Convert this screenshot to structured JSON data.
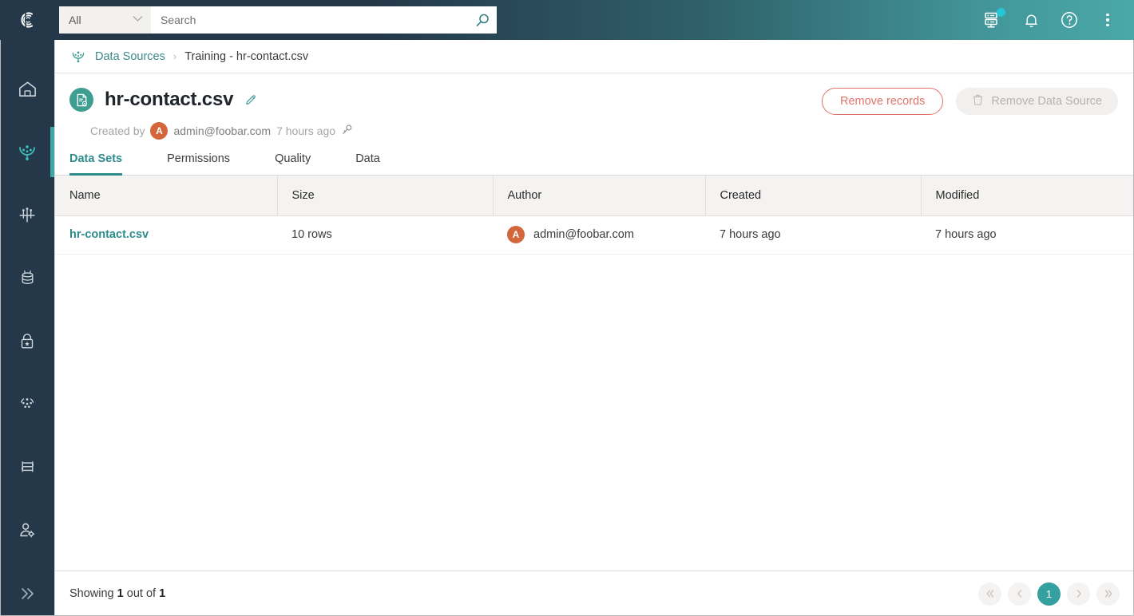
{
  "topbar": {
    "logo_icon": "c-logo-icon",
    "search": {
      "scope_value": "All",
      "scope_caret_icon": "chevron-down-icon",
      "placeholder": "Search",
      "value": "",
      "search_icon": "search-icon"
    },
    "icons": [
      {
        "name": "server-tasks-icon",
        "has_badge": true
      },
      {
        "name": "bell-icon",
        "has_badge": false
      },
      {
        "name": "help-circle-icon",
        "has_badge": false
      },
      {
        "name": "kebab-menu-icon",
        "has_badge": false
      }
    ]
  },
  "sidebar": {
    "items": [
      {
        "name": "sidebar-item-home",
        "icon": "home-icon",
        "active": false
      },
      {
        "name": "sidebar-item-data-sources",
        "icon": "data-sources-icon",
        "active": true
      },
      {
        "name": "sidebar-item-catalog",
        "icon": "catalog-network-icon",
        "active": false
      },
      {
        "name": "sidebar-item-database",
        "icon": "database-icon",
        "active": false
      },
      {
        "name": "sidebar-item-policies",
        "icon": "lock-star-icon",
        "active": false
      },
      {
        "name": "sidebar-item-discovery",
        "icon": "dots-network-icon",
        "active": false
      },
      {
        "name": "sidebar-item-workflows",
        "icon": "flow-pipeline-icon",
        "active": false
      },
      {
        "name": "sidebar-item-user-admin",
        "icon": "user-settings-icon",
        "active": false
      }
    ],
    "expand_icon": "chevron-double-right-icon"
  },
  "breadcrumb": {
    "icon": "data-sources-icon",
    "root_label": "Data Sources",
    "separator": "›",
    "current_label": "Training - hr-contact.csv"
  },
  "page": {
    "icon": "data-source-file-icon",
    "title": "hr-contact.csv",
    "edit_icon": "pencil-icon",
    "meta": {
      "created_by_label": "Created by",
      "avatar_initial": "A",
      "email": "admin@foobar.com",
      "time": "7 hours ago",
      "key_icon": "key-icon"
    },
    "actions": {
      "remove_records_label": "Remove records",
      "remove_datasource_label": "Remove Data Source",
      "remove_datasource_icon": "trash-icon",
      "remove_datasource_disabled": true
    }
  },
  "tabs": [
    {
      "label": "Data Sets",
      "active": true
    },
    {
      "label": "Permissions",
      "active": false
    },
    {
      "label": "Quality",
      "active": false
    },
    {
      "label": "Data",
      "active": false
    }
  ],
  "table": {
    "columns": [
      "Name",
      "Size",
      "Author",
      "Created",
      "Modified"
    ],
    "rows": [
      {
        "name": "hr-contact.csv",
        "size": "10 rows",
        "author_initial": "A",
        "author": "admin@foobar.com",
        "created": "7 hours ago",
        "modified": "7 hours ago"
      }
    ]
  },
  "footer": {
    "showing_prefix": "Showing",
    "showing_count": "1",
    "showing_middle": "out of",
    "showing_total": "1",
    "pagination": {
      "first_icon": "chevron-double-left-icon",
      "prev_icon": "chevron-left-icon",
      "current_page": "1",
      "next_icon": "chevron-right-icon",
      "last_icon": "chevron-double-right-icon"
    }
  },
  "colors": {
    "brand_teal": "#2e8b8b",
    "navy": "#24384a",
    "danger": "#e0736b",
    "avatar_orange": "#d4663c",
    "active_page": "#34a0a0"
  }
}
